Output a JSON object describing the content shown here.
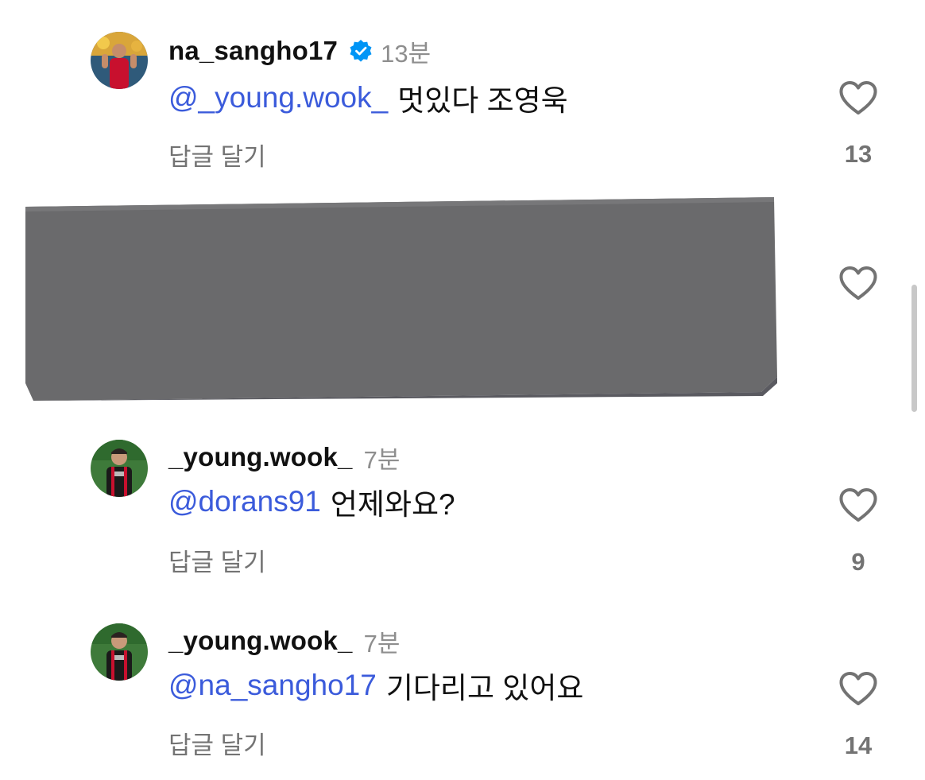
{
  "comments": [
    {
      "username": "na_sangho17",
      "verified": true,
      "time": "13분",
      "mention": "@_young.wook_",
      "text": "멋있다 조영욱",
      "reply_label": "답글 달기",
      "likes": "13",
      "avatar_icon": "profile-photo-red-jersey"
    },
    {
      "username": "_young.wook_",
      "verified": false,
      "time": "7분",
      "mention": "@dorans91",
      "text": "언제와요?",
      "reply_label": "답글 달기",
      "likes": "9",
      "avatar_icon": "profile-photo-black-jersey"
    },
    {
      "username": "_young.wook_",
      "verified": false,
      "time": "7분",
      "mention": "@na_sangho17",
      "text": "기다리고 있어요",
      "reply_label": "답글 달기",
      "likes": "14",
      "avatar_icon": "profile-photo-black-jersey"
    }
  ],
  "colors": {
    "mention": "#3b5bdb",
    "verified": "#0095f6",
    "muted": "#737373",
    "redacted": "#6a6a6c"
  },
  "icons": {
    "like": "heart-outline-icon",
    "verified": "verified-badge-icon"
  }
}
